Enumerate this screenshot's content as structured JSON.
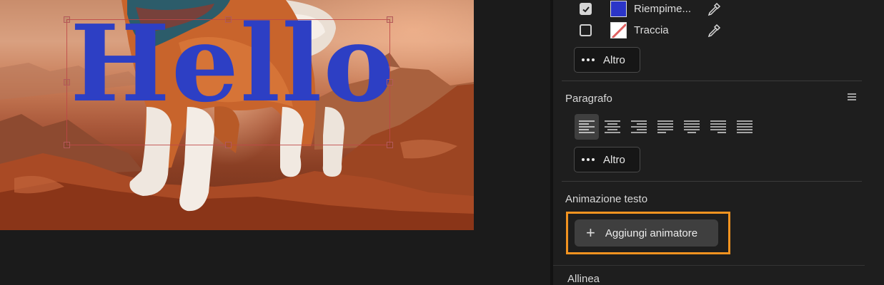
{
  "canvas": {
    "text_layer": "Hello",
    "text_color": "#2d3fc4"
  },
  "panel": {
    "appearance": {
      "fill": {
        "label": "Riempime...",
        "checked": true,
        "color": "#2b35c8"
      },
      "stroke": {
        "label": "Traccia",
        "checked": false,
        "color": "none"
      },
      "more_label": "Altro"
    },
    "paragraph": {
      "title": "Paragrafo",
      "more_label": "Altro",
      "align_options": [
        "left",
        "center",
        "right",
        "justify-left",
        "justify-center",
        "justify-right",
        "justify-all"
      ],
      "active_align": "left"
    },
    "text_animation": {
      "title": "Animazione testo",
      "add_animator_label": "Aggiungi animatore",
      "highlight_color": "#f29320"
    },
    "next_section_title": "Allinea"
  }
}
